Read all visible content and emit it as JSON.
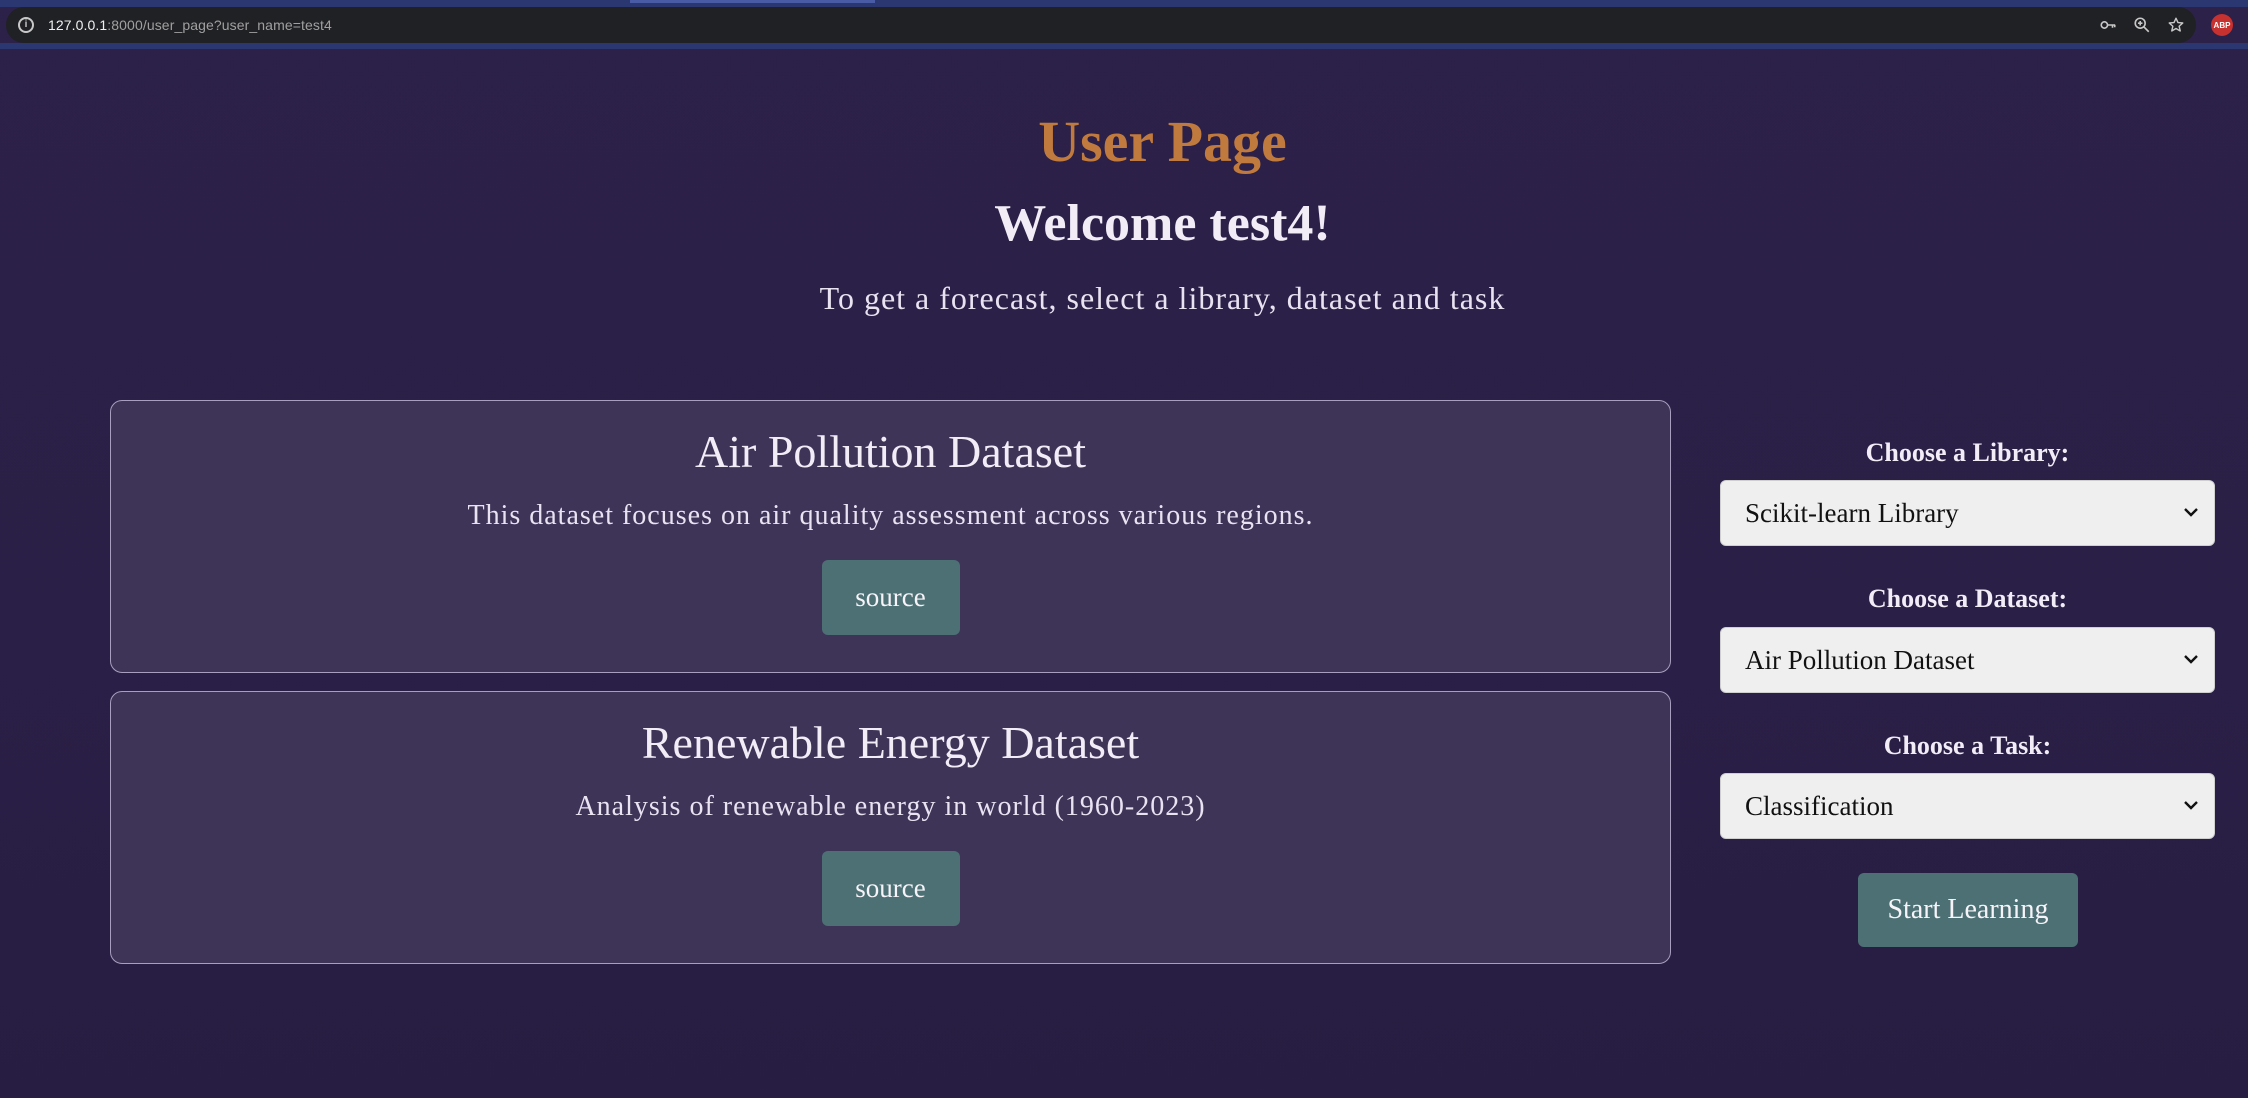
{
  "browser": {
    "url_host": "127.0.0.1",
    "url_rest": ":8000/user_page?user_name=test4",
    "extension_badge": "ABP"
  },
  "header": {
    "title": "User Page",
    "welcome": "Welcome test4!",
    "subtitle": "To get a forecast, select a library, dataset and task"
  },
  "datasets": [
    {
      "title": "Air Pollution Dataset",
      "description": "This dataset focuses on air quality assessment across various regions.",
      "button": "source"
    },
    {
      "title": "Renewable Energy Dataset",
      "description": "Analysis of renewable energy in world (1960-2023)",
      "button": "source"
    }
  ],
  "form": {
    "library_label": "Choose a Library:",
    "library_value": "Scikit-learn Library",
    "dataset_label": "Choose a Dataset:",
    "dataset_value": "Air Pollution Dataset",
    "task_label": "Choose a Task:",
    "task_value": "Classification",
    "submit": "Start Learning"
  },
  "colors": {
    "background": "#2a1f46",
    "title_accent": "#c17a3e",
    "button": "#4d7075",
    "card": "#3e3458"
  }
}
